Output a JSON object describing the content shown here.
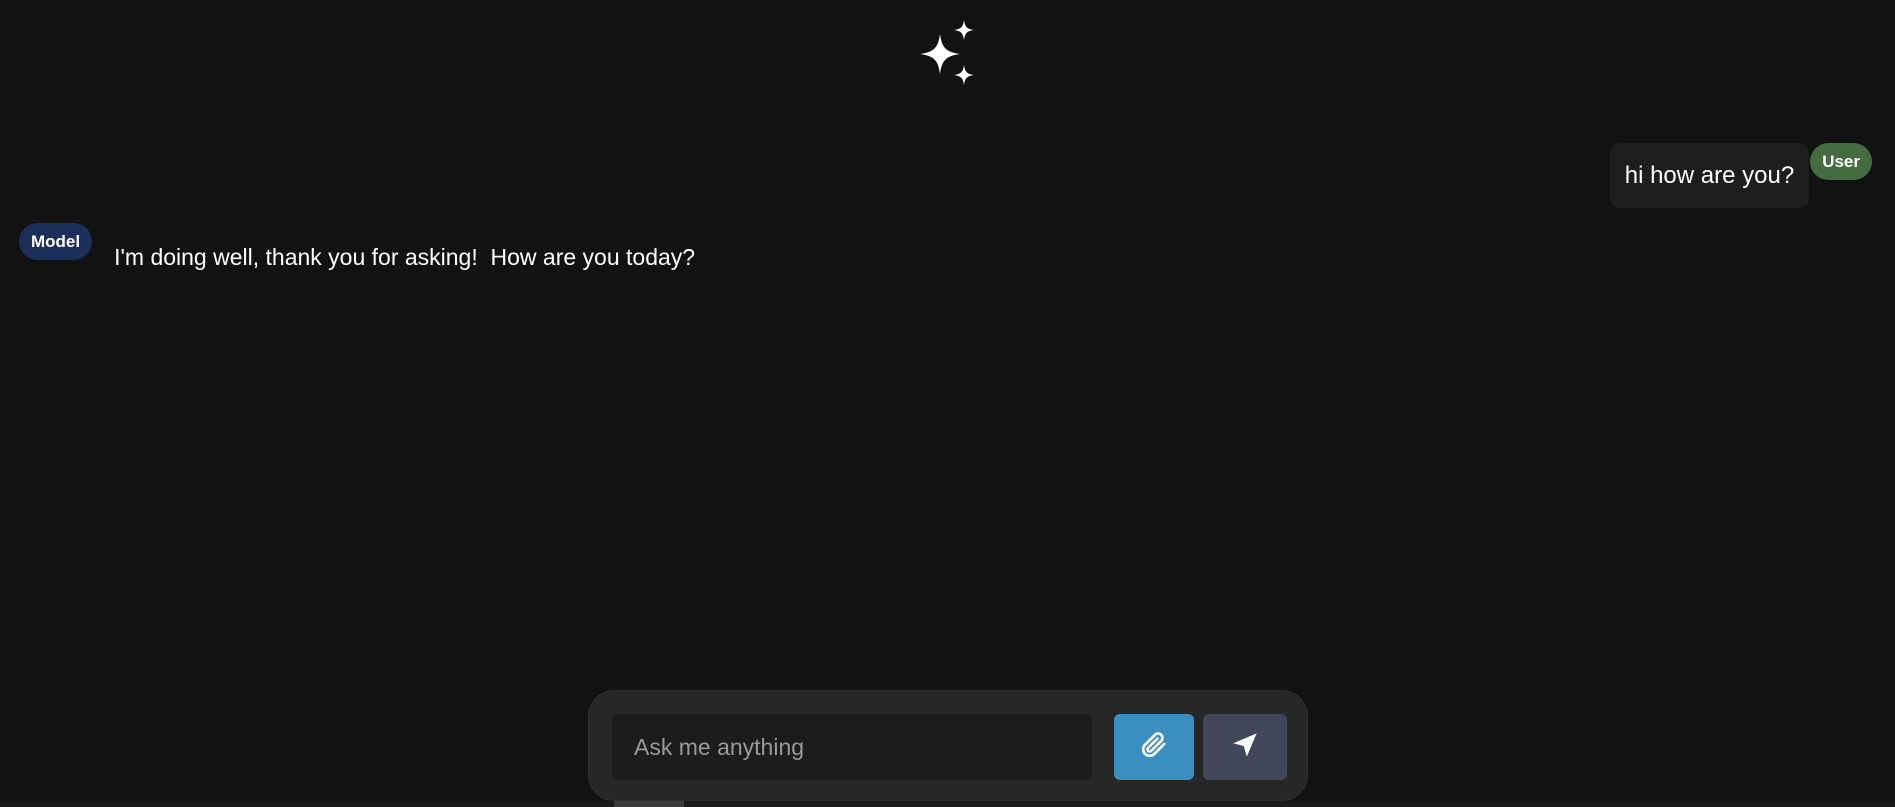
{
  "header": {
    "logo_icon": "sparkles-icon"
  },
  "messages": [
    {
      "role_label": "User",
      "text": "hi how are you?",
      "badge_color": "#456b40"
    },
    {
      "role_label": "Model",
      "text": "I'm doing well, thank you for asking!  How are you today?",
      "badge_color": "#1c2e5a"
    }
  ],
  "composer": {
    "placeholder": "Ask me anything",
    "value": "",
    "attach_icon": "paperclip-icon",
    "send_icon": "send-icon",
    "attach_color": "#3a8fc0",
    "send_color": "#414759"
  }
}
